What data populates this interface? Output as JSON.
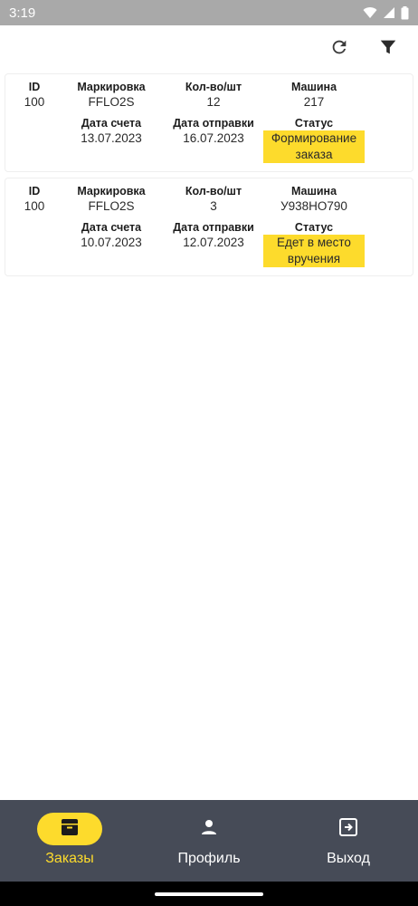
{
  "status_bar": {
    "time": "3:19"
  },
  "labels": {
    "id": "ID",
    "marking": "Маркировка",
    "quantity": "Кол-во/шт",
    "car": "Машина",
    "invoice_date": "Дата счета",
    "shipping_date": "Дата отправки",
    "status": "Статус"
  },
  "orders": [
    {
      "id": "100",
      "marking": "FFLO2S",
      "quantity": "12",
      "car": "217",
      "invoice_date": "13.07.2023",
      "shipping_date": "16.07.2023",
      "status": "Формирование заказа"
    },
    {
      "id": "100",
      "marking": "FFLO2S",
      "quantity": "3",
      "car": "У938НО790",
      "invoice_date": "10.07.2023",
      "shipping_date": "12.07.2023",
      "status": "Едет в место вручения"
    }
  ],
  "bottom_nav": [
    {
      "label": "Заказы",
      "icon": "archive-icon",
      "active": true
    },
    {
      "label": "Профиль",
      "icon": "person-icon",
      "active": false
    },
    {
      "label": "Выход",
      "icon": "logout-icon",
      "active": false
    }
  ],
  "colors": {
    "accent": "#fddb2c",
    "nav_bg": "#464b57",
    "status_bar": "#a9a9a9"
  }
}
